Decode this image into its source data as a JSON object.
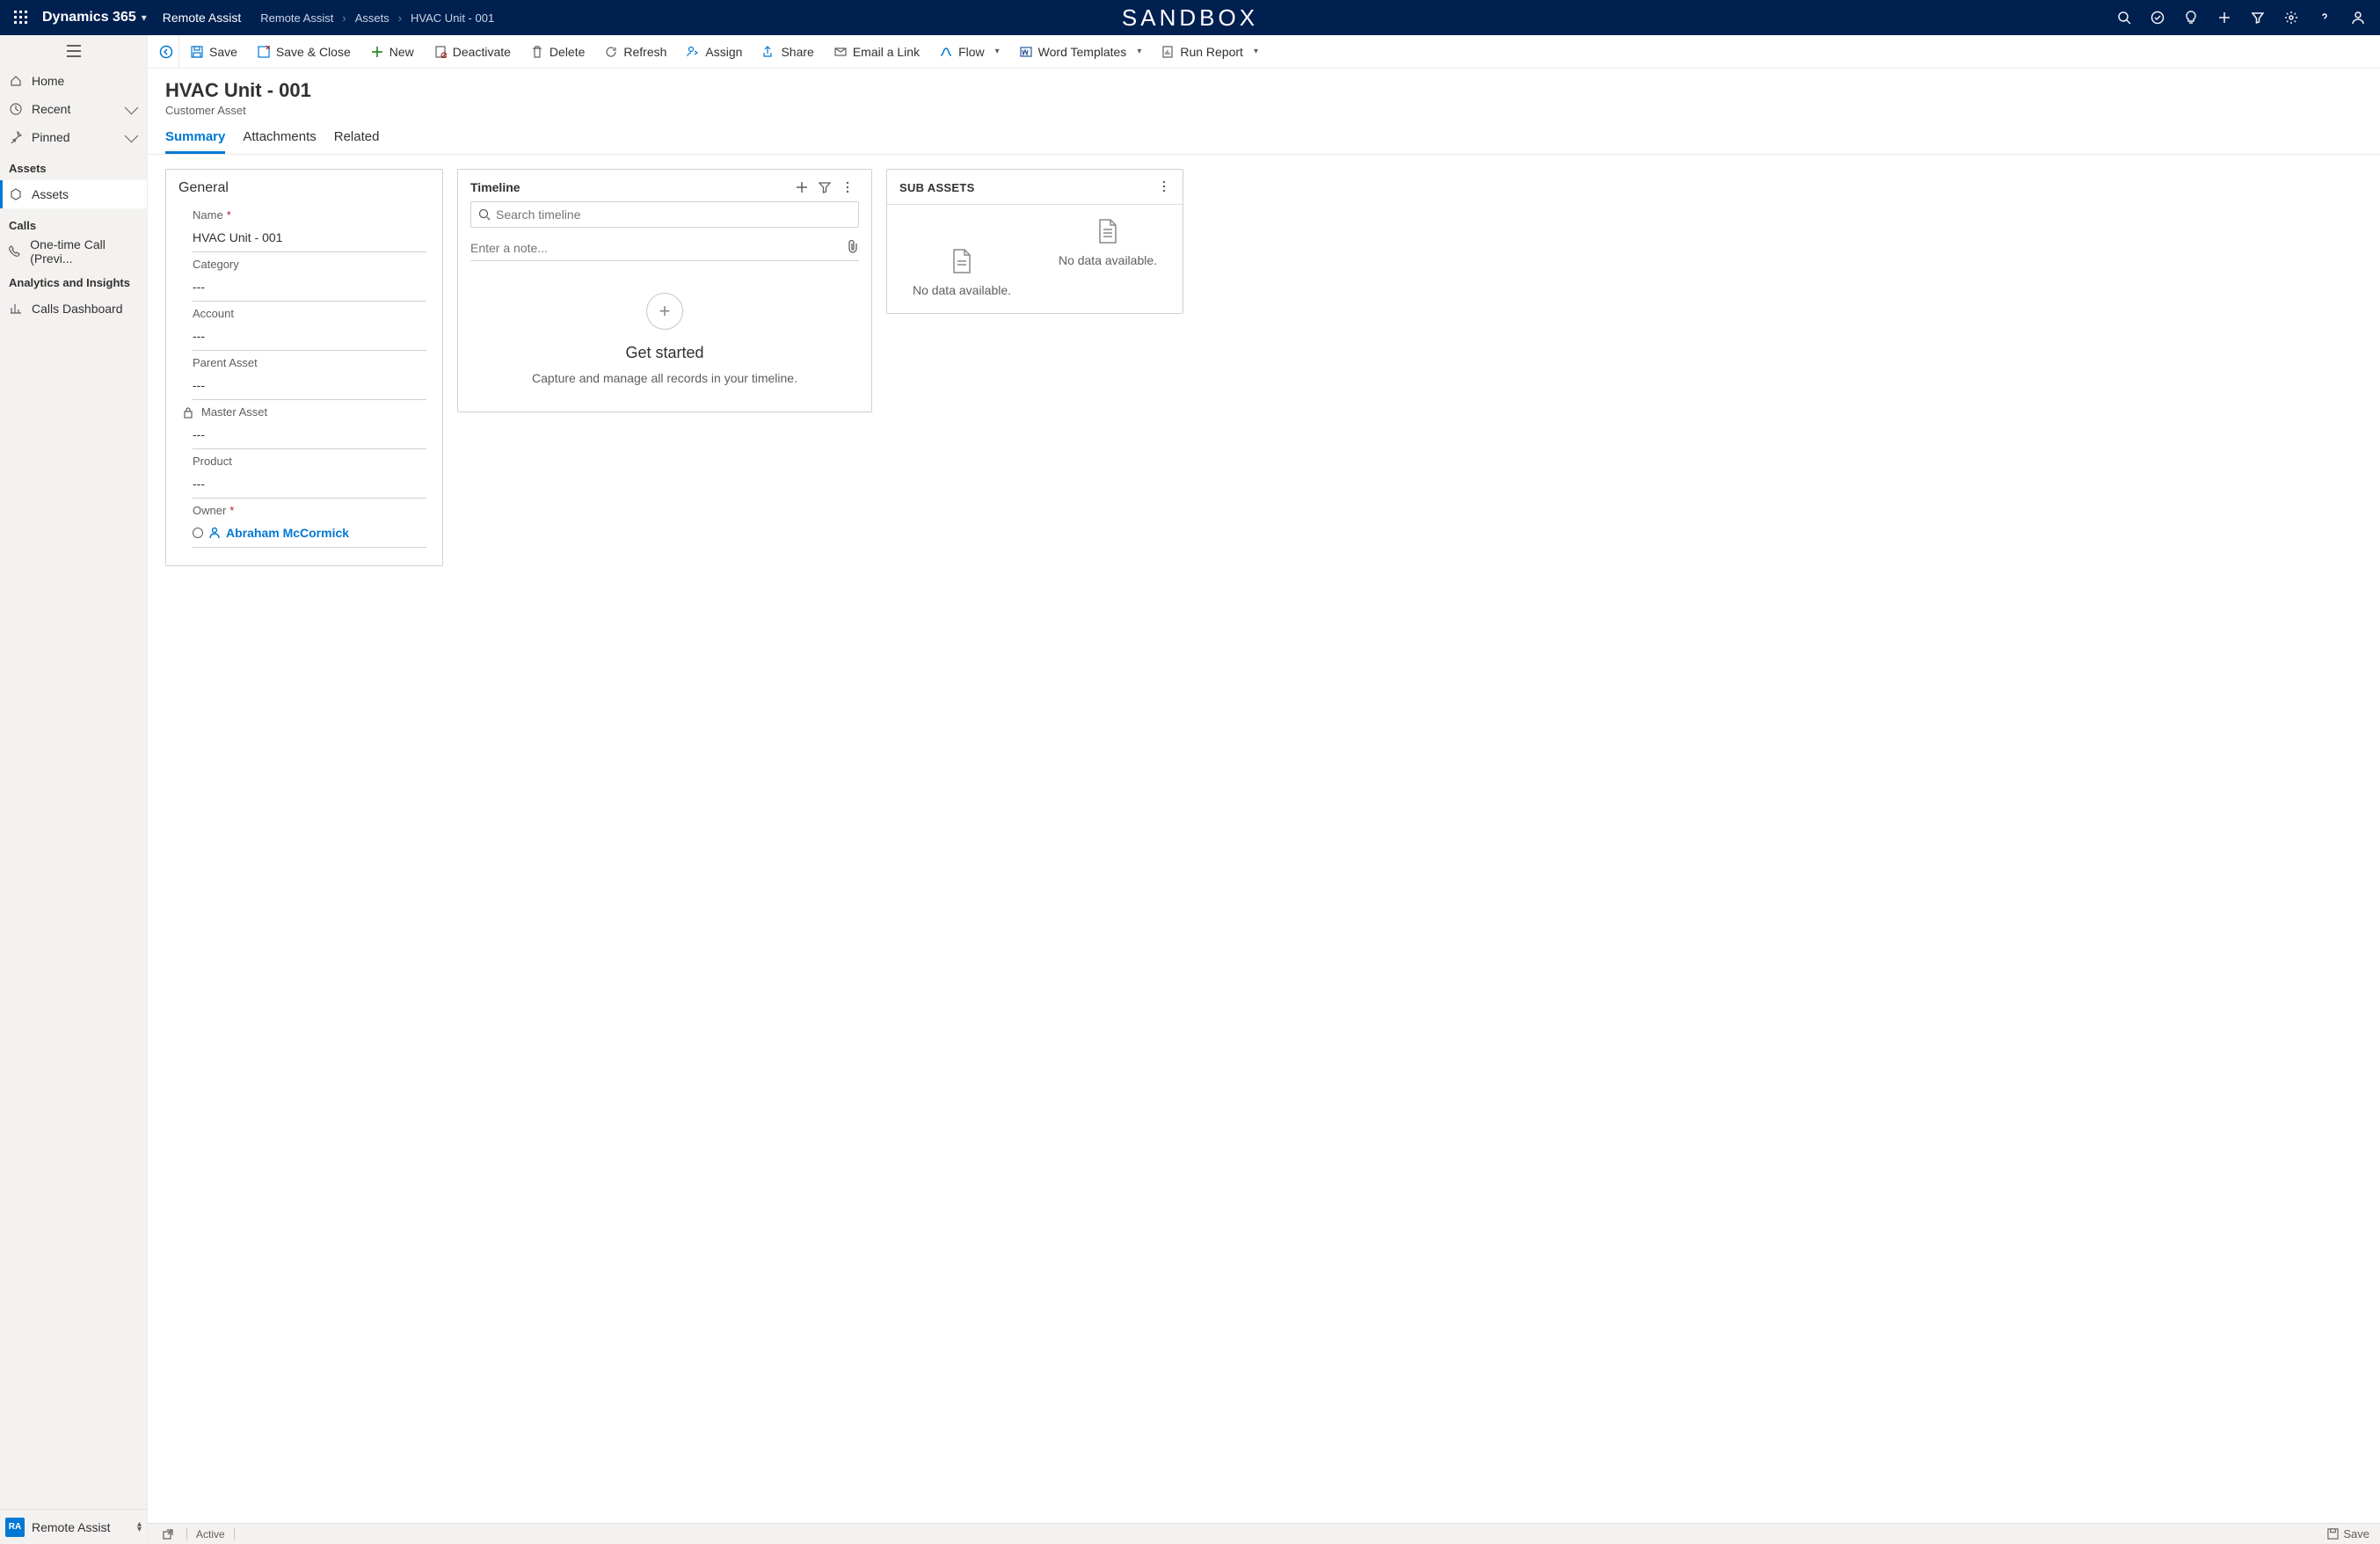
{
  "topbar": {
    "brand": "Dynamics 365",
    "app": "Remote Assist",
    "crumbs": [
      "Remote Assist",
      "Assets",
      "HVAC Unit - 001"
    ],
    "env": "SANDBOX"
  },
  "nav": {
    "home": "Home",
    "recent": "Recent",
    "pinned": "Pinned",
    "group_assets": "Assets",
    "assets": "Assets",
    "group_calls": "Calls",
    "one_time_call": "One-time Call (Previ...",
    "group_analytics": "Analytics and Insights",
    "calls_dashboard": "Calls Dashboard",
    "footer_badge": "RA",
    "footer_label": "Remote Assist"
  },
  "cmd": {
    "save": "Save",
    "save_close": "Save & Close",
    "new": "New",
    "deactivate": "Deactivate",
    "delete": "Delete",
    "refresh": "Refresh",
    "assign": "Assign",
    "share": "Share",
    "email": "Email a Link",
    "flow": "Flow",
    "word": "Word Templates",
    "report": "Run Report"
  },
  "record": {
    "title": "HVAC Unit - 001",
    "subtitle": "Customer Asset"
  },
  "tabs": {
    "summary": "Summary",
    "attachments": "Attachments",
    "related": "Related"
  },
  "general": {
    "title": "General",
    "name_label": "Name",
    "name_value": "HVAC Unit - 001",
    "category_label": "Category",
    "category_value": "---",
    "account_label": "Account",
    "account_value": "---",
    "parent_label": "Parent Asset",
    "parent_value": "---",
    "master_label": "Master Asset",
    "master_value": "---",
    "product_label": "Product",
    "product_value": "---",
    "owner_label": "Owner",
    "owner_value": "Abraham McCormick"
  },
  "timeline": {
    "title": "Timeline",
    "search_placeholder": "Search timeline",
    "note_placeholder": "Enter a note...",
    "empty_title": "Get started",
    "empty_text": "Capture and manage all records in your timeline."
  },
  "subassets": {
    "title": "SUB ASSETS",
    "nodata": "No data available."
  },
  "status": {
    "state": "Active",
    "save": "Save"
  }
}
